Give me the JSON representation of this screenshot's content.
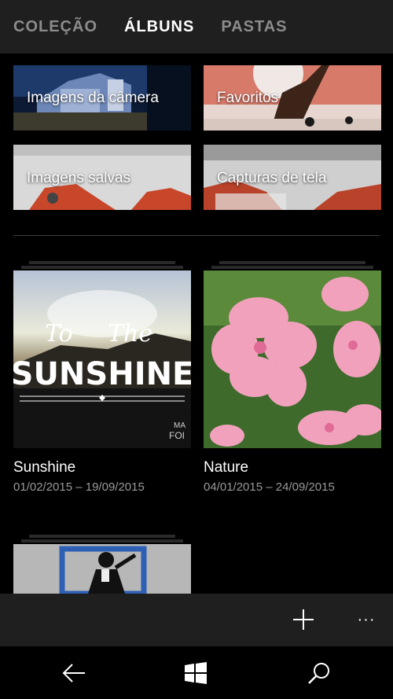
{
  "pivot": {
    "tabs": [
      {
        "label": "COLEÇÃO"
      },
      {
        "label": "ÁLBUNS"
      },
      {
        "label": "PASTAS"
      }
    ],
    "active_index": 1
  },
  "folders": [
    {
      "label": "Imagens da câmera"
    },
    {
      "label": "Favoritos"
    },
    {
      "label": "Imagens salvas"
    },
    {
      "label": "Capturas de tela"
    }
  ],
  "albums": [
    {
      "title": "Sunshine",
      "dates": "01/02/2015 – 19/09/2015",
      "cover_text": {
        "line1": "To",
        "line2": "The",
        "line3": "SUNSHINE",
        "corner1": "MA",
        "corner2": "FOI"
      }
    },
    {
      "title": "Nature",
      "dates": "04/01/2015 – 24/09/2015"
    }
  ],
  "app_bar": {
    "add_icon": "add-icon",
    "more_icon": "more-icon",
    "more_label": "···"
  },
  "nav_bar": {
    "back_icon": "back-icon",
    "windows_icon": "windows-logo-icon",
    "search_icon": "search-icon"
  },
  "colors": {
    "header_bg": "#1f1f1f",
    "inactive_tab": "#8c8c8c",
    "date_text": "#9a9a9a"
  }
}
